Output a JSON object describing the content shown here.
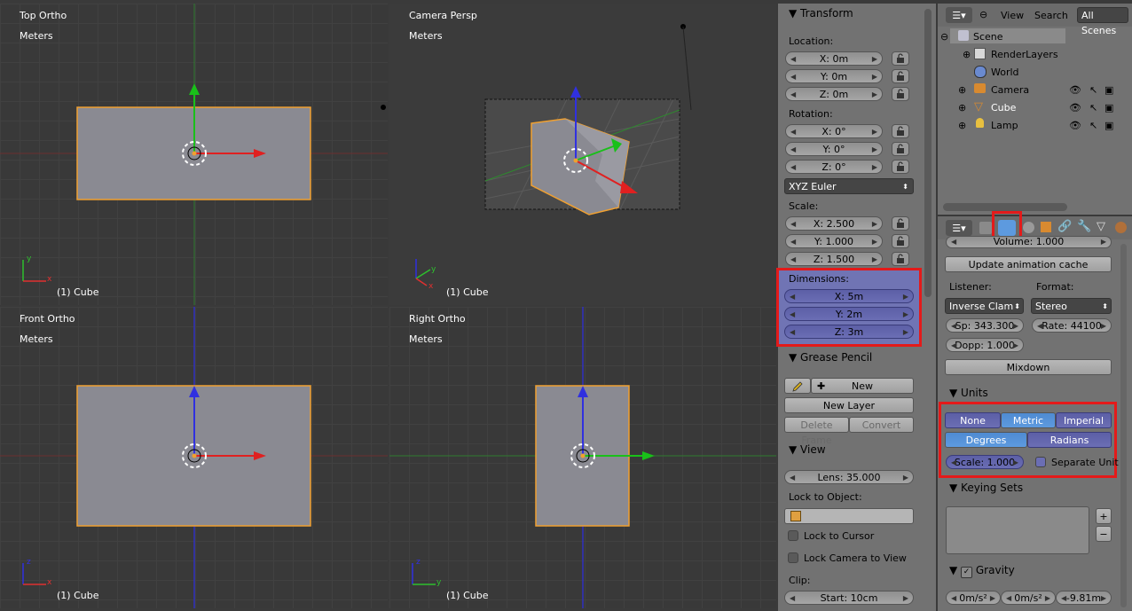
{
  "viewports": {
    "top_left": {
      "title": "Top Ortho",
      "units": "Meters",
      "object": "(1) Cube"
    },
    "top_right": {
      "title": "Camera Persp",
      "units": "Meters",
      "object": "(1) Cube"
    },
    "bottom_left": {
      "title": "Front Ortho",
      "units": "Meters",
      "object": "(1) Cube"
    },
    "bottom_right": {
      "title": "Right Ortho",
      "units": "Meters",
      "object": "(1) Cube"
    }
  },
  "transform": {
    "header": "Transform",
    "location_label": "Location:",
    "location": [
      "X: 0m",
      "Y: 0m",
      "Z: 0m"
    ],
    "rotation_label": "Rotation:",
    "rotation": [
      "X: 0°",
      "Y: 0°",
      "Z: 0°"
    ],
    "rotation_mode": "XYZ Euler",
    "scale_label": "Scale:",
    "scale": [
      "X: 2.500",
      "Y: 1.000",
      "Z: 1.500"
    ],
    "dimensions_label": "Dimensions:",
    "dimensions": [
      "X: 5m",
      "Y: 2m",
      "Z: 3m"
    ]
  },
  "grease_pencil": {
    "header": "Grease Pencil",
    "new_label": "New",
    "new_layer_label": "New Layer",
    "delete_frame_label": "Delete Frame",
    "convert_label": "Convert"
  },
  "view": {
    "header": "View",
    "lens": "Lens: 35.000",
    "lock_to_object_label": "Lock to Object:",
    "lock_to_cursor_label": "Lock to Cursor",
    "lock_camera_label": "Lock Camera to View",
    "clip_label": "Clip:",
    "clip_start": "Start: 10cm"
  },
  "outliner": {
    "view_label": "View",
    "search_label": "Search",
    "scenes_label": "All Scenes",
    "items": [
      {
        "label": "Scene"
      },
      {
        "label": "RenderLayers"
      },
      {
        "label": "World"
      },
      {
        "label": "Camera"
      },
      {
        "label": "Cube"
      },
      {
        "label": "Lamp"
      }
    ]
  },
  "scene_props": {
    "volume": "Volume: 1.000",
    "update_cache_label": "Update animation cache",
    "listener_label": "Listener:",
    "format_label": "Format:",
    "listener_value": "Inverse Clam",
    "format_value": "Stereo",
    "speed": "Sp: 343.300",
    "rate": "Rate: 44100",
    "doppler": "Dopp: 1.000",
    "mixdown_label": "Mixdown",
    "units_header": "Units",
    "unit_none": "None",
    "unit_metric": "Metric",
    "unit_imperial": "Imperial",
    "unit_degrees": "Degrees",
    "unit_radians": "Radians",
    "unit_scale": "Scale: 1.000",
    "separate_units_label": "Separate Unit",
    "keying_sets_header": "Keying Sets",
    "gravity_header": "Gravity",
    "gravity": [
      "0m/s²",
      "0m/s²",
      "-9.81m"
    ]
  },
  "colors": {
    "highlight": "#e41a1a",
    "selected_blue": "#5d9adf",
    "object_outline": "#f0a030"
  }
}
